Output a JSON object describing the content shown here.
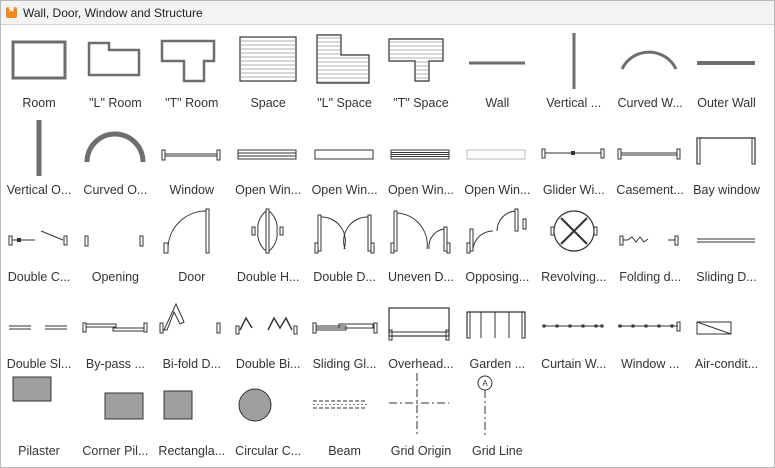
{
  "window": {
    "title": "Wall, Door, Window and Structure",
    "accent": "#f28a1e"
  },
  "shapes": [
    {
      "label": "Room",
      "icon": "room-icon"
    },
    {
      "label": "\"L\" Room",
      "icon": "l-room-icon"
    },
    {
      "label": "\"T\" Room",
      "icon": "t-room-icon"
    },
    {
      "label": "Space",
      "icon": "space-icon"
    },
    {
      "label": "\"L\" Space",
      "icon": "l-space-icon"
    },
    {
      "label": "\"T\" Space",
      "icon": "t-space-icon"
    },
    {
      "label": "Wall",
      "icon": "wall-icon"
    },
    {
      "label": "Vertical ...",
      "icon": "vertical-wall-icon"
    },
    {
      "label": "Curved W...",
      "icon": "curved-wall-icon"
    },
    {
      "label": "Outer Wall",
      "icon": "outer-wall-icon"
    },
    {
      "label": "Vertical O...",
      "icon": "vertical-outer-wall-icon"
    },
    {
      "label": "Curved O...",
      "icon": "curved-outer-wall-icon"
    },
    {
      "label": "Window",
      "icon": "window-icon"
    },
    {
      "label": "Open Win...",
      "icon": "open-window-1-icon"
    },
    {
      "label": "Open Win...",
      "icon": "open-window-2-icon"
    },
    {
      "label": "Open Win...",
      "icon": "open-window-3-icon"
    },
    {
      "label": "Open Win...",
      "icon": "open-window-4-icon"
    },
    {
      "label": "Glider Wi...",
      "icon": "glider-window-icon"
    },
    {
      "label": "Casement...",
      "icon": "casement-window-icon"
    },
    {
      "label": "Bay window",
      "icon": "bay-window-icon"
    },
    {
      "label": "Double C...",
      "icon": "double-casement-icon"
    },
    {
      "label": "Opening",
      "icon": "opening-icon"
    },
    {
      "label": "Door",
      "icon": "door-icon"
    },
    {
      "label": "Double H...",
      "icon": "double-hung-door-icon"
    },
    {
      "label": "Double D...",
      "icon": "double-door-icon"
    },
    {
      "label": "Uneven D...",
      "icon": "uneven-door-icon"
    },
    {
      "label": "Opposing...",
      "icon": "opposing-door-icon"
    },
    {
      "label": "Revolving...",
      "icon": "revolving-door-icon"
    },
    {
      "label": "Folding d...",
      "icon": "folding-door-icon"
    },
    {
      "label": "Sliding D...",
      "icon": "sliding-door-icon"
    },
    {
      "label": "Double Sl...",
      "icon": "double-sliding-door-icon"
    },
    {
      "label": "By-pass ...",
      "icon": "bypass-door-icon"
    },
    {
      "label": "Bi-fold D...",
      "icon": "bifold-door-icon"
    },
    {
      "label": "Double Bi...",
      "icon": "double-bifold-door-icon"
    },
    {
      "label": "Sliding Gl...",
      "icon": "sliding-glass-door-icon"
    },
    {
      "label": "Overhead...",
      "icon": "overhead-door-icon"
    },
    {
      "label": "Garden ...",
      "icon": "garden-door-icon"
    },
    {
      "label": "Curtain W...",
      "icon": "curtain-wall-icon"
    },
    {
      "label": "Window ...",
      "icon": "window-wall-icon"
    },
    {
      "label": "Air-condit...",
      "icon": "air-conditioner-icon"
    },
    {
      "label": "Pilaster",
      "icon": "pilaster-icon"
    },
    {
      "label": "Corner Pil...",
      "icon": "corner-pilaster-icon"
    },
    {
      "label": "Rectangla...",
      "icon": "rectangular-column-icon"
    },
    {
      "label": "Circular C...",
      "icon": "circular-column-icon"
    },
    {
      "label": "Beam",
      "icon": "beam-icon"
    },
    {
      "label": "Grid Origin",
      "icon": "grid-origin-icon"
    },
    {
      "label": "Grid Line",
      "icon": "grid-line-icon"
    }
  ],
  "grid_line_marker": "A"
}
